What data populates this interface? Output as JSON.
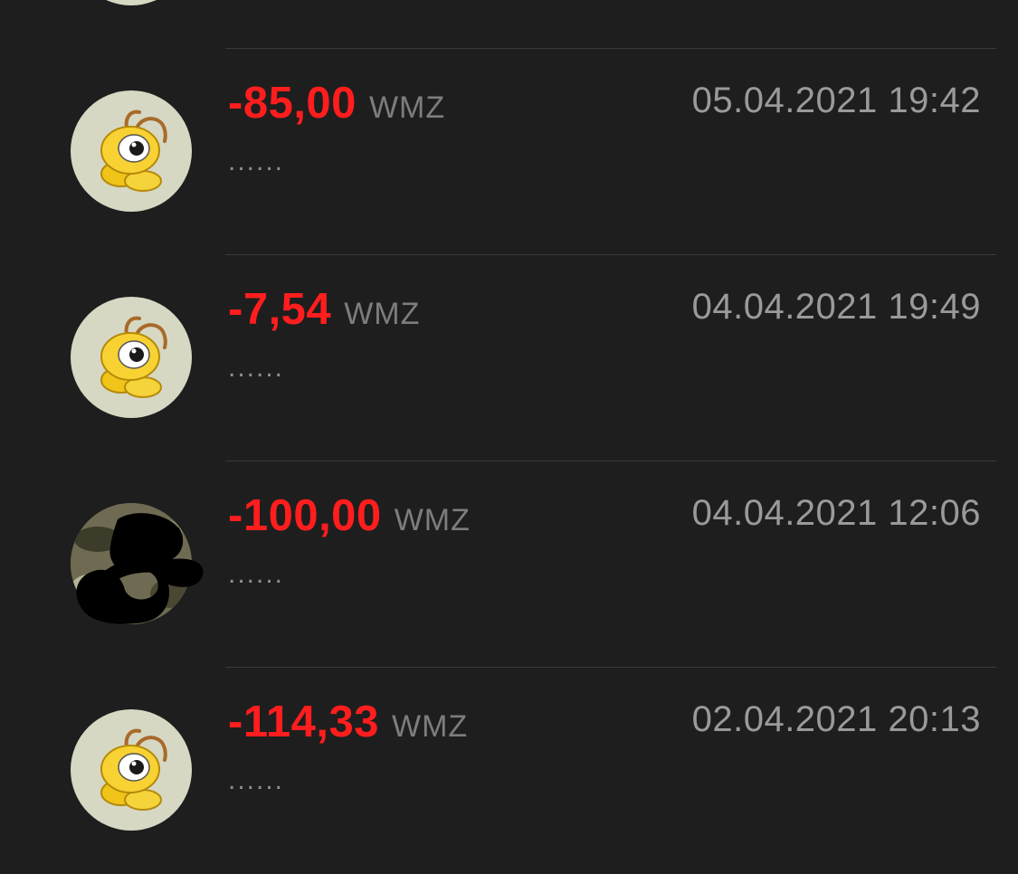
{
  "transactions": [
    {
      "amount": "-85,00",
      "currency": "WMZ",
      "datetime": "05.04.2021 19:42",
      "note": "......",
      "avatar": "webmoney-ant-icon"
    },
    {
      "amount": "-7,54",
      "currency": "WMZ",
      "datetime": "04.04.2021 19:49",
      "note": "......",
      "avatar": "webmoney-ant-icon"
    },
    {
      "amount": "-100,00",
      "currency": "WMZ",
      "datetime": "04.04.2021 12:06",
      "note": "......",
      "avatar": "redacted-photo-avatar"
    },
    {
      "amount": "-114,33",
      "currency": "WMZ",
      "datetime": "02.04.2021 20:13",
      "note": "......",
      "avatar": "webmoney-ant-icon"
    }
  ],
  "colors": {
    "background": "#1e1e1e",
    "amount_negative": "#ff1d1d",
    "secondary_text": "#9a9a9a",
    "divider": "#3a3a3a",
    "avatar_bg": "#d6d8c3"
  }
}
